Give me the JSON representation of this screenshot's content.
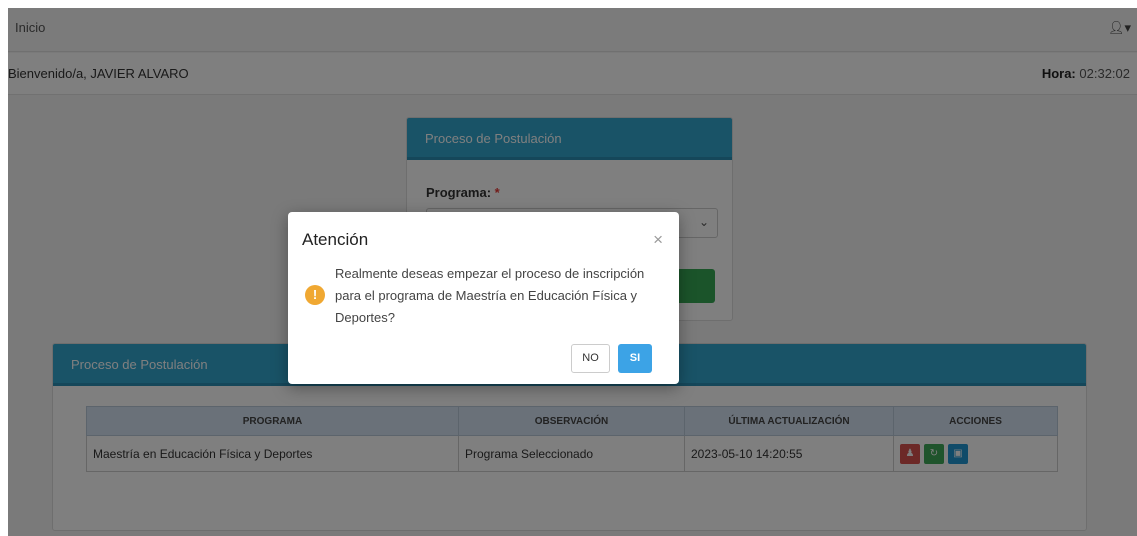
{
  "navbar": {
    "title": "Inicio",
    "user_icon": "user-icon"
  },
  "welcome": {
    "text": "Bienvenido/a, JAVIER ALVARO"
  },
  "clock": {
    "label": "Hora:",
    "time": "02:32:02"
  },
  "top_panel": {
    "heading": "Proceso de Postulación",
    "field_label": "Programa:",
    "required_mark": "*",
    "select_value": ""
  },
  "bottom_panel": {
    "heading": "Proceso de Postulación",
    "columns": [
      "PROGRAMA",
      "OBSERVACIÓN",
      "ÚLTIMA ACTUALIZACIÓN",
      "ACCIONES"
    ],
    "rows": [
      {
        "programa": "Maestría en Educación Física y Deportes",
        "observacion": "Programa Seleccionado",
        "fecha": "2023-05-10 14:20:55"
      }
    ],
    "action_icons": [
      "user-icon",
      "refresh-icon",
      "lock-icon"
    ],
    "action_colors": [
      "#d9534f",
      "#3ea858",
      "#2196d3"
    ]
  },
  "modal": {
    "title": "Atención",
    "close_glyph": "×",
    "icon_glyph": "!",
    "message": "Realmente deseas empezar el proceso de inscripción para el programa de Maestría en Educación Física y Deportes?",
    "no_label": "NO",
    "si_label": "SI"
  },
  "colors": {
    "panel_heading": "#33a7cf",
    "primary": "#3ca3e6",
    "warning": "#f0a832",
    "success": "#37a854"
  }
}
